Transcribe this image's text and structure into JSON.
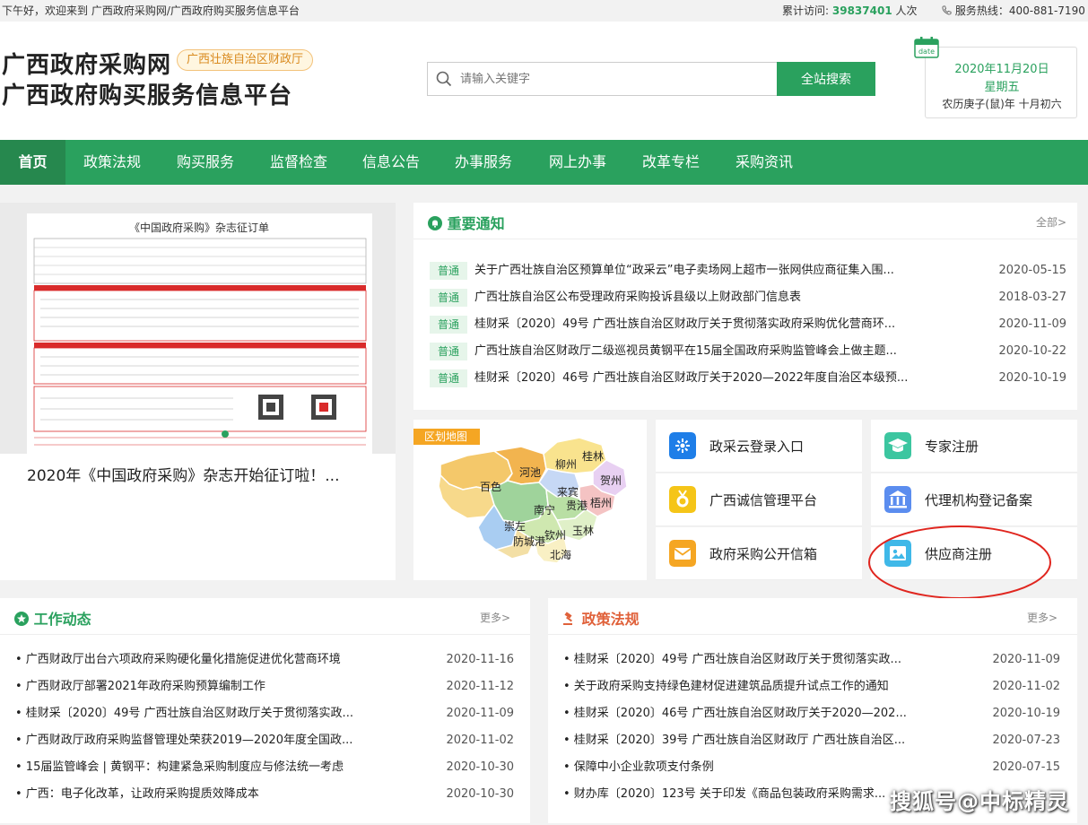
{
  "topbar": {
    "welcome": "下午好，欢迎来到 广西政府采购网/广西政府购买服务信息平台",
    "visits_label": "累计访问:",
    "visits_count": "39837401",
    "visits_unit": "人次",
    "hotline": "服务热线：400-881-7190"
  },
  "header": {
    "logo_line1": "广西政府采购网",
    "logo_line2": "广西政府购买服务信息平台",
    "org_badge": "广西壮族自治区财政厅",
    "search_placeholder": "请输入关键字",
    "search_button": "全站搜索",
    "date_icon_label": "date",
    "date": "2020年11月20日",
    "weekday": "星期五",
    "lunar": "农历庚子(鼠)年 十月初六"
  },
  "nav": {
    "items": [
      "首页",
      "政策法规",
      "购买服务",
      "监督检查",
      "信息公告",
      "办事服务",
      "网上办事",
      "改革专栏",
      "采购资讯"
    ]
  },
  "slider": {
    "image_title": "《中国政府采购》杂志征订单",
    "caption": "2020年《中国政府采购》杂志开始征订啦！..."
  },
  "notice": {
    "title": "重要通知",
    "more": "全部>",
    "items": [
      {
        "tag": "普通",
        "text": "关于广西壮族自治区预算单位“政采云”电子卖场网上超市一张网供应商征集入围...",
        "date": "2020-05-15"
      },
      {
        "tag": "普通",
        "text": "广西壮族自治区公布受理政府采购投诉县级以上财政部门信息表",
        "date": "2018-03-27"
      },
      {
        "tag": "普通",
        "text": "桂财采〔2020〕49号 广西壮族自治区财政厅关于贯彻落实政府采购优化营商环...",
        "date": "2020-11-09"
      },
      {
        "tag": "普通",
        "text": "广西壮族自治区财政厅二级巡视员黄钢平在15届全国政府采购监管峰会上做主题...",
        "date": "2020-10-22"
      },
      {
        "tag": "普通",
        "text": "桂财采〔2020〕46号 广西壮族自治区财政厅关于2020—2022年度自治区本级预...",
        "date": "2020-10-19"
      }
    ]
  },
  "map": {
    "tag": "区划地图",
    "cities": [
      "桂林",
      "河池",
      "柳州",
      "贺州",
      "百色",
      "来宾",
      "梧州",
      "南宁",
      "贵港",
      "崇左",
      "玉林",
      "钦州",
      "防城港",
      "北海"
    ]
  },
  "quick_links": [
    {
      "label": "政采云登录入口",
      "icon": "cloud-login-icon",
      "color": "#1e7ee8"
    },
    {
      "label": "专家注册",
      "icon": "graduation-cap-icon",
      "color": "#3cc6a0"
    },
    {
      "label": "广西诚信管理平台",
      "icon": "medal-icon",
      "color": "#f5c518"
    },
    {
      "label": "代理机构登记备案",
      "icon": "bank-icon",
      "color": "#5b8def"
    },
    {
      "label": "政府采购公开信箱",
      "icon": "mail-icon",
      "color": "#f5a623"
    },
    {
      "label": "供应商注册",
      "icon": "supplier-icon",
      "color": "#3fb8e8"
    }
  ],
  "work_news": {
    "title": "工作动态",
    "more": "更多>",
    "items": [
      {
        "text": "• 广西财政厅出台六项政府采购硬化量化措施促进优化营商环境",
        "date": "2020-11-16"
      },
      {
        "text": "• 广西财政厅部署2021年政府采购预算编制工作",
        "date": "2020-11-12"
      },
      {
        "text": "• 桂财采〔2020〕49号 广西壮族自治区财政厅关于贯彻落实政...",
        "date": "2020-11-09"
      },
      {
        "text": "• 广西财政厅政府采购监督管理处荣获2019—2020年度全国政...",
        "date": "2020-11-02"
      },
      {
        "text": "• 15届监管峰会 | 黄钢平：构建紧急采购制度应与修法统一考虑",
        "date": "2020-10-30"
      },
      {
        "text": "• 广西：电子化改革，让政府采购提质效降成本",
        "date": "2020-10-30"
      }
    ]
  },
  "policy": {
    "title": "政策法规",
    "more": "更多>",
    "items": [
      {
        "text": "• 桂财采〔2020〕49号 广西壮族自治区财政厅关于贯彻落实政...",
        "date": "2020-11-09"
      },
      {
        "text": "• 关于政府采购支持绿色建材促进建筑品质提升试点工作的通知",
        "date": "2020-11-02"
      },
      {
        "text": "• 桂财采〔2020〕46号 广西壮族自治区财政厅关于2020—202...",
        "date": "2020-10-19"
      },
      {
        "text": "• 桂财采〔2020〕39号 广西壮族自治区财政厅 广西壮族自治区...",
        "date": "2020-07-23"
      },
      {
        "text": "• 保障中小企业款项支付条例",
        "date": "2020-07-15"
      },
      {
        "text": "• 财办库〔2020〕123号 关于印发《商品包装政府采购需求...",
        "date": ""
      }
    ]
  },
  "watermark": "搜狐号@中标精灵",
  "colors": {
    "brand_green": "#2aa15e",
    "nav_active": "#26884e",
    "annotation_red": "#e0261f"
  }
}
